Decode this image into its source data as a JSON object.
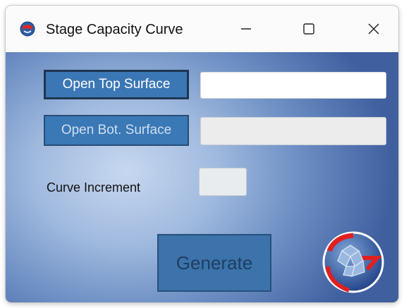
{
  "window": {
    "title": "Stage Capacity Curve",
    "app_icon": "app-globe-icon",
    "controls": {
      "minimize_icon": "minimize-icon",
      "maximize_icon": "maximize-icon",
      "close_icon": "close-icon"
    }
  },
  "form": {
    "open_top_label": "Open Top Surface",
    "open_top_path": "",
    "open_bot_label": "Open Bot. Surface",
    "open_bot_path": "",
    "curve_increment_label": "Curve Increment",
    "curve_increment_value": "",
    "generate_label": "Generate"
  },
  "logo": {
    "icon": "company-logo-icon"
  },
  "colors": {
    "background_center": "#c7d8f0",
    "background_edge": "#3f5f9f",
    "button_fill": "#3b77b5",
    "button_border": "#1f3550"
  }
}
